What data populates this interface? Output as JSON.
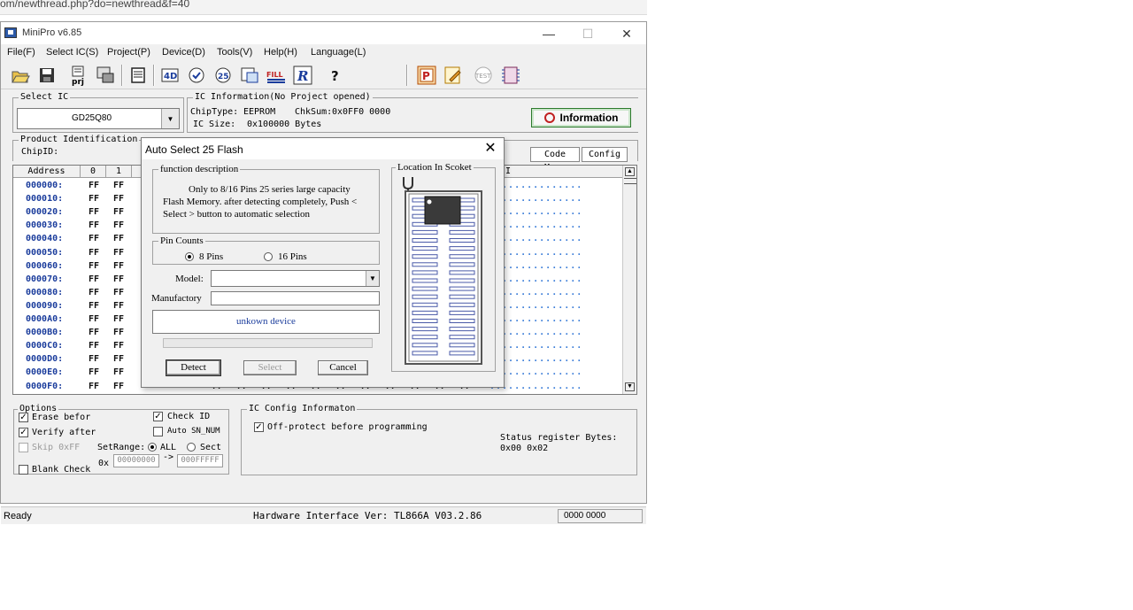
{
  "browser": {
    "url_fragment": "om/newthread.php?do=newthread&f=40"
  },
  "window": {
    "title": "MiniPro v6.85",
    "controls": {
      "minimize": "—",
      "maximize": "☐",
      "close": "✕"
    }
  },
  "menu": [
    "File(F)",
    "Select IC(S)",
    "Project(P)",
    "Device(D)",
    "Tools(V)",
    "Help(H)",
    "Language(L)"
  ],
  "toolbar": {
    "icons": [
      "open-icon",
      "save-icon",
      "project-icon",
      "chip-icon",
      "memory-icon",
      "read-icon",
      "verify-icon",
      "blank-icon",
      "erase-icon",
      "fill-icon",
      "r-icon",
      "help-icon",
      "p-icon",
      "edit-icon",
      "test-icon",
      "chip-config-icon"
    ],
    "labels": {
      "prj": "prj",
      "fill": "FILL",
      "r": "R",
      "help": "?",
      "p": "P",
      "test": "TEST",
      "four_d": "4D",
      "twenty_five": "25"
    }
  },
  "select_ic": {
    "title": "Select IC",
    "value": "GD25Q80"
  },
  "ic_info": {
    "title": "IC Information(No Project opened)",
    "chip_type_label": "ChipType:",
    "chip_type": "EEPROM",
    "chksum_label": "ChkSum:",
    "chksum": "0x0FF0 0000",
    "ic_size_label": "IC Size:",
    "ic_size": "0x100000 Bytes"
  },
  "info_button": "Information",
  "product_id": {
    "title": "Product Identification",
    "chipid_label": "ChipID:"
  },
  "tabs": {
    "code_memo": "Code Memo",
    "config": "Config"
  },
  "hex_grid": {
    "headers": [
      "Address",
      "0",
      "1"
    ],
    "ascii_header": "II",
    "rows": [
      {
        "addr": "000000:",
        "bytes": [
          "FF",
          "FF"
        ]
      },
      {
        "addr": "000010:",
        "bytes": [
          "FF",
          "FF"
        ]
      },
      {
        "addr": "000020:",
        "bytes": [
          "FF",
          "FF"
        ]
      },
      {
        "addr": "000030:",
        "bytes": [
          "FF",
          "FF"
        ]
      },
      {
        "addr": "000040:",
        "bytes": [
          "FF",
          "FF"
        ]
      },
      {
        "addr": "000050:",
        "bytes": [
          "FF",
          "FF"
        ]
      },
      {
        "addr": "000060:",
        "bytes": [
          "FF",
          "FF"
        ]
      },
      {
        "addr": "000070:",
        "bytes": [
          "FF",
          "FF"
        ]
      },
      {
        "addr": "000080:",
        "bytes": [
          "FF",
          "FF"
        ]
      },
      {
        "addr": "000090:",
        "bytes": [
          "FF",
          "FF"
        ]
      },
      {
        "addr": "0000A0:",
        "bytes": [
          "FF",
          "FF"
        ]
      },
      {
        "addr": "0000B0:",
        "bytes": [
          "FF",
          "FF"
        ]
      },
      {
        "addr": "0000C0:",
        "bytes": [
          "FF",
          "FF"
        ]
      },
      {
        "addr": "0000D0:",
        "bytes": [
          "FF",
          "FF"
        ]
      },
      {
        "addr": "0000E0:",
        "bytes": [
          "FF",
          "FF"
        ]
      },
      {
        "addr": "0000F0:",
        "bytes": [
          "FF",
          "FF"
        ]
      }
    ],
    "last_row_extra_bytes": [
      "FF",
      "FF",
      "FF",
      "FF",
      "FF",
      "FF",
      "FF",
      "FF",
      "FF",
      "FF",
      "FF",
      "FF",
      "FF",
      "FF"
    ],
    "ascii_dots": "..............."
  },
  "options": {
    "title": "Options",
    "erase_before": "Erase befor",
    "verify_after": "Verify after",
    "skip_0xff": "Skip 0xFF",
    "blank_check": "Blank Check",
    "check_id": "Check ID",
    "auto_sn": "Auto SN_NUM",
    "set_range": "SetRange:",
    "all": "ALL",
    "sect": "Sect",
    "ox": "0x",
    "range_from": "00000000",
    "arrow": "->",
    "range_to": "000FFFFF",
    "erase_checked": true,
    "verify_checked": true,
    "check_id_checked": true
  },
  "ic_config": {
    "title": "IC Config Informaton",
    "off_protect": "Off-protect before programming",
    "status_label": "Status register Bytes:",
    "status_value": "0x00 0x02"
  },
  "status_bar": {
    "left": "Ready",
    "hardware": "Hardware Interface Ver: TL866A V03.2.86",
    "right": "0000 0000"
  },
  "dialog": {
    "title": "Auto Select 25 Flash",
    "close": "✕",
    "function_description_title": "function description",
    "function_description_text": "Only to 8/16 Pins 25 series large capacity Flash Memory. after detecting completely, Push < Select > button to automatic selection",
    "pin_counts_title": "Pin Counts",
    "pin_8": "8 Pins",
    "pin_16": "16 Pins",
    "model_label": "Model:",
    "model_value": "",
    "manufactory_label": "Manufactory",
    "manufactory_value": "",
    "device_status": "unkown device",
    "progress": 0,
    "location_title": "Location In Scoket",
    "buttons": {
      "detect": "Detect",
      "select": "Select",
      "cancel": "Cancel"
    }
  },
  "colors": {
    "address_blue": "#1a3c9c",
    "ascii_dots_blue": "#3b7dd8",
    "info_button_border": "#2c7a2c",
    "device_status_text": "#1a3c9c",
    "socket_pin_blue": "#4a5aa8"
  }
}
